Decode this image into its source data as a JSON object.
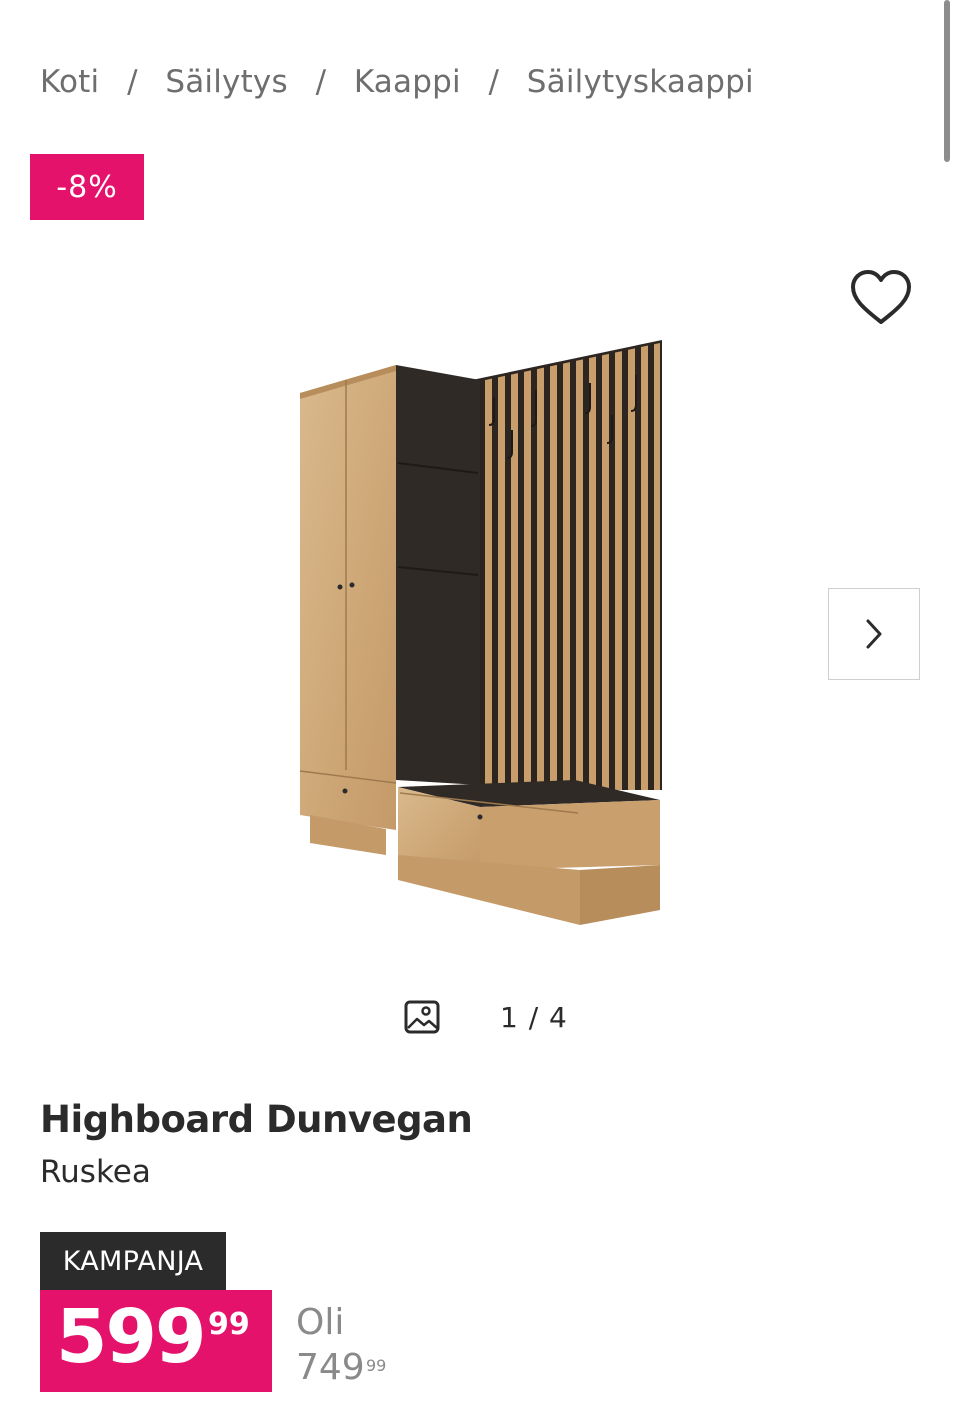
{
  "breadcrumb": {
    "items": [
      "Koti",
      "Säilytys",
      "Kaappi",
      "Säilytyskaappi"
    ],
    "separator": "/"
  },
  "badge": {
    "discount": "-8%"
  },
  "gallery": {
    "counter": "1 / 4",
    "current": 1,
    "total": 4,
    "icons": {
      "wishlist": "heart-icon",
      "next": "chevron-right-icon",
      "gallery": "image-icon"
    }
  },
  "product": {
    "name": "Highboard Dunvegan",
    "color": "Ruskea"
  },
  "price": {
    "label": "KAMPANJA",
    "current_main": "599",
    "current_cents": "99",
    "old_label": "Oli",
    "old_main": "749",
    "old_cents": "99"
  },
  "colors": {
    "accent": "#e4126b",
    "dark": "#2b2b2b",
    "muted": "#8a8a8a"
  }
}
